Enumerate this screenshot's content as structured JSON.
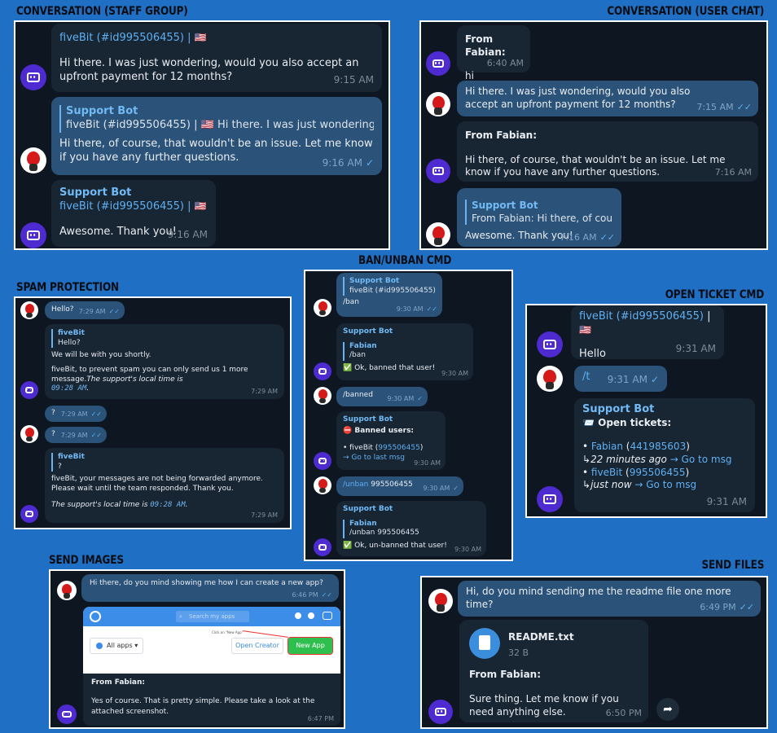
{
  "labels": {
    "staff": "Conversation (staff group)",
    "user": "Conversation (user chat)",
    "ban": "Ban/Unban CMD",
    "spam": "Spam Protection",
    "ticket": "Open Ticket CMD",
    "images": "Send Images",
    "files": "Send Files"
  },
  "staff": {
    "m1": {
      "header": "fiveBit (#id995506455) |",
      "flag": "🇺🇸",
      "text": "Hi there. I was just wondering, would you also accept an upfront payment for 12 months?",
      "time": "9:15 AM"
    },
    "m2": {
      "qname": "Support Bot",
      "qtext": "fiveBit (#id995506455) |  🇺🇸  Hi there. I was just wondering, woul...",
      "text": "Hi there, of course, that wouldn't be an issue. Let me know if you have any further questions.",
      "time": "9:16 AM"
    },
    "m3": {
      "name": "Support Bot",
      "header": "fiveBit (#id995506455) |",
      "flag": "🇺🇸",
      "text": "Awesome. Thank you!",
      "time": "9:16 AM"
    }
  },
  "userchat": {
    "m1": {
      "from": "From Fabian:",
      "text": "hi",
      "time": "6:40 AM"
    },
    "m2": {
      "text": "Hi there. I was just wondering, would you also accept an upfront payment for 12 months?",
      "time": "7:15 AM"
    },
    "m3": {
      "from": "From Fabian:",
      "text": "Hi there, of course, that wouldn't be an issue. Let me know if you have any further questions.",
      "time": "7:16 AM"
    },
    "m4": {
      "qname": "Support Bot",
      "qtext": "From Fabian:  Hi there, of cours...",
      "text": "Awesome. Thank you!",
      "time": "7:16 AM"
    }
  },
  "spam": {
    "m1": {
      "text": "Hello?",
      "time": "7:29 AM"
    },
    "m2": {
      "qname": "fiveBit",
      "qtext": "Hello?",
      "l1": "We will be with you shortly.",
      "l2": "fiveBit, to prevent spam you can only send us 1 more message.",
      "l2b": "The support's local time is",
      "l3": "09:28 AM",
      "l3b": ".",
      "time": "7:29 AM"
    },
    "m3": {
      "text": "?",
      "time": "7:29 AM"
    },
    "m4": {
      "text": "?",
      "time": "7:29 AM"
    },
    "m5": {
      "qname": "fiveBit",
      "qtext": "?",
      "l1": "fiveBit, your messages are not being forwarded anymore. Please wait until the team responded. Thank you.",
      "l2": "The support's local time is",
      "l3": "09:28 AM",
      "l3b": ".",
      "time": "7:29 AM"
    }
  },
  "ban": {
    "m1": {
      "qname": "Support Bot",
      "qtext": "fiveBit (#id995506455) ...",
      "text": "/ban",
      "time": "9:30 AM"
    },
    "m2": {
      "name": "Support Bot",
      "qname": "Fabian",
      "qtext": "/ban",
      "text": "✅ Ok, banned that user!",
      "time": "9:30 AM"
    },
    "m3": {
      "text": "/banned",
      "time": "9:30 AM"
    },
    "m4": {
      "name": "Support Bot",
      "title": "⛔ Banned users:",
      "l1": "• fiveBit (",
      "l1id": "995506455",
      "l1end": ")",
      "l2": "→ Go to last msg",
      "time": "9:30 AM"
    },
    "m5": {
      "cmd": "/unban",
      "arg": " 995506455",
      "time": "9:30 AM"
    },
    "m6": {
      "name": "Support Bot",
      "qname": "Fabian",
      "qtext": "/unban 995506455",
      "text": "✅ Ok, un-banned that user!",
      "time": "9:30 AM"
    }
  },
  "ticket": {
    "m1": {
      "name": "fiveBit",
      "id": "(#id995506455)",
      "sep": "|",
      "flag": "🇺🇸",
      "text": "Hello",
      "time": "9:31 AM"
    },
    "m2": {
      "text": "/t",
      "time": "9:31 AM"
    },
    "m3": {
      "name": "Support Bot",
      "title": "📨 Open tickets:",
      "u1": "Fabian",
      "u1id": "441985603",
      "u1ago": "22 minutes ago",
      "u1link": "→ Go to msg",
      "u2": "fiveBit",
      "u2id": "995506455",
      "u2ago": "just now",
      "u2link": "→ Go to msg",
      "time": "9:31 AM"
    }
  },
  "images": {
    "m1": {
      "text": "Hi there, do you mind showing me how I can create a new app?",
      "time": "6:46 PM"
    },
    "shot": {
      "search": "Search my apps",
      "filter": "All apps",
      "hint": "Click on \"New App\"",
      "open": "Open Creator",
      "new": "New App"
    },
    "m2": {
      "from": "From Fabian:",
      "text": "Yes of course. That is pretty simple. Please take a look at the attached screenshot.",
      "time": "6:47 PM"
    }
  },
  "files": {
    "m1": {
      "text": "Hi, do you mind sending me the readme file one more time?",
      "time": "6:49 PM"
    },
    "m2": {
      "filename": "README.txt",
      "size": "32 B",
      "from": "From Fabian:",
      "text": "Sure thing. Let me know if you need anything else.",
      "time": "6:50 PM"
    }
  },
  "icons": [
    "bot-avatar-icon",
    "user-avatar-icon",
    "double-check-icon",
    "file-icon",
    "share-icon",
    "search-icon"
  ]
}
